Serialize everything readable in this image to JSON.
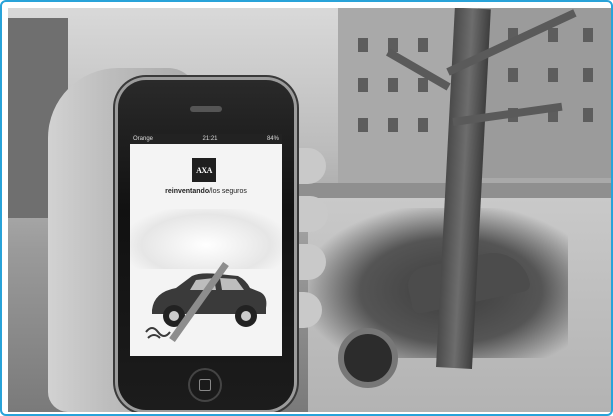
{
  "scene": {
    "description_colors": {
      "frame_border": "#29a3d9"
    }
  },
  "phone": {
    "status_bar": {
      "carrier": "Orange",
      "time": "21:21",
      "battery": "84%"
    },
    "app": {
      "logo_text": "AXA",
      "slogan_bold": "reinventando",
      "slogan_rest": "/los seguros"
    },
    "icons": {
      "home": "home-button-icon",
      "car": "car-crossed-icon"
    }
  }
}
